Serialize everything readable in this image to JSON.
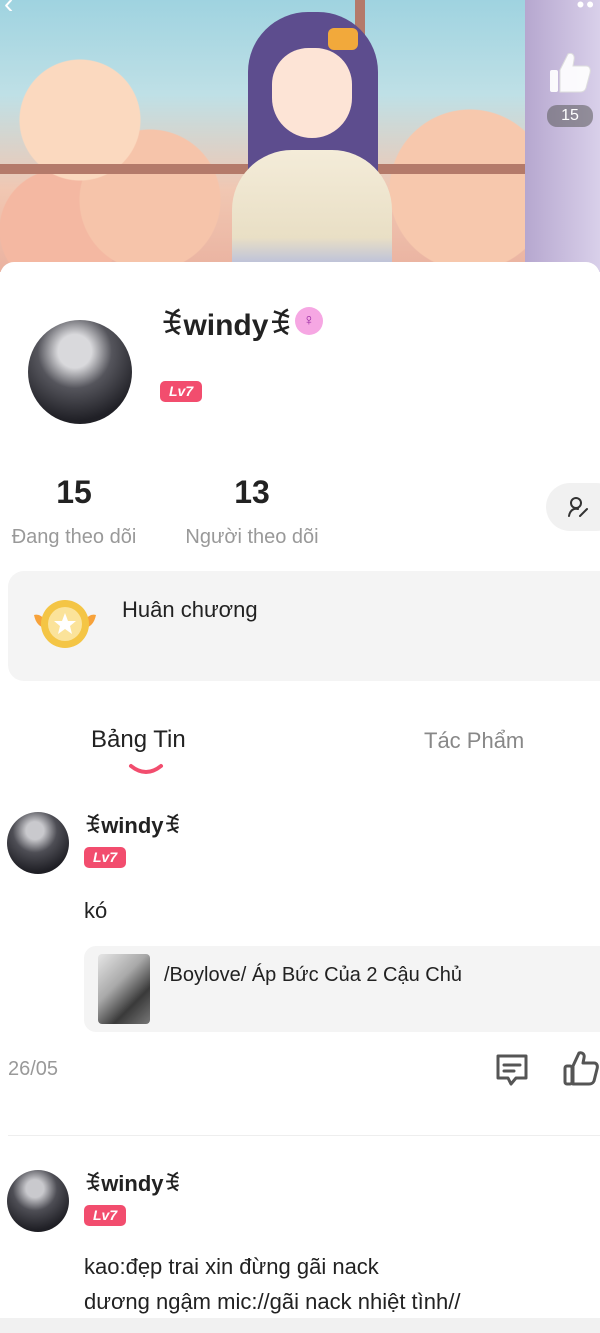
{
  "header": {
    "back_icon": "chevron-left-icon",
    "more_icon": "more-dots-icon",
    "like_icon": "thumbs-up-icon",
    "like_count": "15"
  },
  "profile": {
    "username": "ꉂwindyꉂ",
    "gender_icon": "female-icon",
    "level": "Lv7",
    "following_count": "15",
    "following_label": "Đang theo dõi",
    "followers_count": "13",
    "followers_label": "Người theo dõi",
    "edit_icon": "edit-profile-icon"
  },
  "medal": {
    "title": "Huân chương",
    "icon": "medal-icon"
  },
  "tabs": [
    {
      "label": "Bảng Tin",
      "active": true
    },
    {
      "label": "Tác Phẩm",
      "active": false
    }
  ],
  "posts": [
    {
      "author": "ꉂwindyꉂ",
      "level": "Lv7",
      "text": "kó",
      "linked_title": "/Boylove/ Áp Bức Của 2 Cậu Chủ",
      "date": "26/05",
      "comment_icon": "comment-icon",
      "like_icon": "thumbs-up-icon"
    },
    {
      "author": "ꉂwindyꉂ",
      "level": "Lv7",
      "text_line1": "kao:đẹp trai xin đừng gãi nack",
      "text_line2": "dương ngậm mic://gãi nack nhiệt tình//"
    }
  ],
  "colors": {
    "accent": "#f24d6e",
    "muted_text": "#999999",
    "card_bg": "#f4f4f4"
  }
}
